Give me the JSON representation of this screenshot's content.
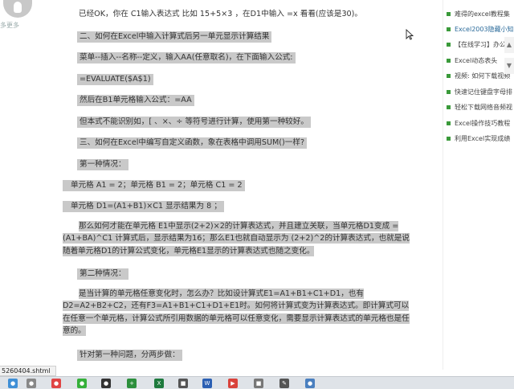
{
  "sidebar": {
    "more_link": "多更多"
  },
  "article": {
    "intro": "已经OK，你在 C1输入表达式 比如 15+5×3 ，在D1中输入 =x 看看(应该是30)。",
    "heading2": "二、如何在Excel中输入计算式后另一单元显示计算结果",
    "menu_path": "菜单--插入--名称--定义，输入AA(任意取名)，在下面输入公式:",
    "formula": "=EVALUATE($A$1)",
    "b1_text": "然后在B1单元格输入公式：=AA",
    "note": "但本式不能识别如，[    、×、÷     等符号进行计算，使用第一种较好。",
    "heading3": "三、如何在Excel中编写自定义函数，象在表格中调用SUM()一样?",
    "case1_title": "第一种情况：",
    "case1_cells": "单元格 A1 = 2；单元格 B1 = 2；单元格 C1 = 2",
    "case1_d1": "单元格 D1=(A1+B1)×C1 显示结果为 8 ；",
    "case1_para": "那么如何才能在单元格 E1中显示(2+2)×2的计算表达式，并且建立关联，当单元格D1变成 =(A1+BA)^C1 计算式后，显示结果为16；那么E1也就自动显示为 (2+2)^2的计算表达式，也就是说随着单元格D1的计算公式变化，单元格E1显示的计算表达式也随之变化。",
    "case2_title": "第二种情况：",
    "case2_para": "是当计算的单元格任意变化时，怎么办？比如设计算式E1=A1+B1+C1+D1，也有D2=A2+B2+C2，还有F3=A1+B1+C1+D1+E1时。如何将计算式变为计算表达式。即计算式可以在任意一个单元格，计算公式所引用数据的单元格可以任意变化，需要显示计算表达式的单元格也是任意的。",
    "case_answer": "针对第一种问题，分两步做："
  },
  "related": {
    "items": [
      "难得的excel教程集",
      "Excel2003隐藏小知",
      "【在线学习】办公室",
      "Excel动态表头",
      "视频: 如何下载视频",
      "快速记住键盘字母排",
      "轻松下载网络音频视",
      "Excel操作技巧教程",
      "利用Excel实现成绩"
    ],
    "scroll_up": "▲",
    "scroll_down": "▼"
  },
  "status": {
    "url": "5260404.shtml"
  },
  "taskbar": {
    "icons": [
      {
        "name": "chrome-icon",
        "glyph": "●",
        "color": "#3f8fd6"
      },
      {
        "name": "user-icon",
        "glyph": "●",
        "color": "#888888"
      },
      {
        "name": "baofeng-icon",
        "glyph": "●",
        "color": "#e04444"
      },
      {
        "name": "wechat-icon",
        "glyph": "●",
        "color": "#35b03a"
      },
      {
        "name": "qq-icon",
        "glyph": "●",
        "color": "#333333"
      },
      {
        "name": "plus-icon",
        "glyph": "+",
        "color": "#2c8f3c"
      },
      {
        "name": "excel-icon",
        "glyph": "X",
        "color": "#1e7a3d"
      },
      {
        "name": "app-icon",
        "glyph": "■",
        "color": "#555555"
      },
      {
        "name": "word-icon",
        "glyph": "W",
        "color": "#2b5fb3"
      },
      {
        "name": "player-icon",
        "glyph": "▶",
        "color": "#d9433b"
      },
      {
        "name": "tool-icon",
        "glyph": "■",
        "color": "#777777"
      },
      {
        "name": "pen-icon",
        "glyph": "✎",
        "color": "#555555"
      },
      {
        "name": "globe-icon",
        "glyph": "●",
        "color": "#4a7fbf"
      }
    ]
  }
}
